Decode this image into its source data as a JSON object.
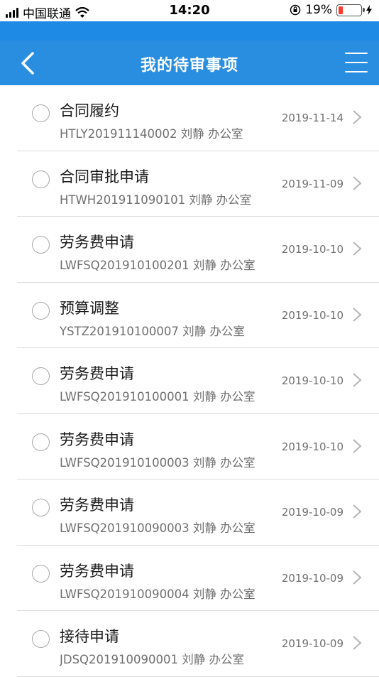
{
  "status_bar": {
    "carrier": "中国联通",
    "time": "14:20",
    "battery": "19%",
    "battery_color": "#ff3b30"
  },
  "nav": {
    "title": "我的待审事项",
    "back_icon": "chevron-left-icon",
    "menu_icon": "hamburger-menu-icon",
    "color": "#2a8ee0"
  },
  "items": [
    {
      "title": "合同履约",
      "subtitle": "HTLY201911140002 刘静 办公室",
      "date": "2019-11-14"
    },
    {
      "title": "合同审批申请",
      "subtitle": "HTWH201911090101 刘静 办公室",
      "date": "2019-11-09"
    },
    {
      "title": "劳务费申请",
      "subtitle": "LWFSQ201910100201 刘静 办公室",
      "date": "2019-10-10"
    },
    {
      "title": "预算调整",
      "subtitle": "YSTZ201910100007 刘静 办公室",
      "date": "2019-10-10"
    },
    {
      "title": "劳务费申请",
      "subtitle": "LWFSQ201910100001 刘静 办公室",
      "date": "2019-10-10"
    },
    {
      "title": "劳务费申请",
      "subtitle": "LWFSQ201910100003 刘静 办公室",
      "date": "2019-10-10"
    },
    {
      "title": "劳务费申请",
      "subtitle": "LWFSQ201910090003 刘静 办公室",
      "date": "2019-10-09"
    },
    {
      "title": "劳务费申请",
      "subtitle": "LWFSQ201910090004 刘静 办公室",
      "date": "2019-10-09"
    },
    {
      "title": "接待申请",
      "subtitle": "JDSQ201910090001 刘静 办公室",
      "date": "2019-10-09"
    }
  ]
}
